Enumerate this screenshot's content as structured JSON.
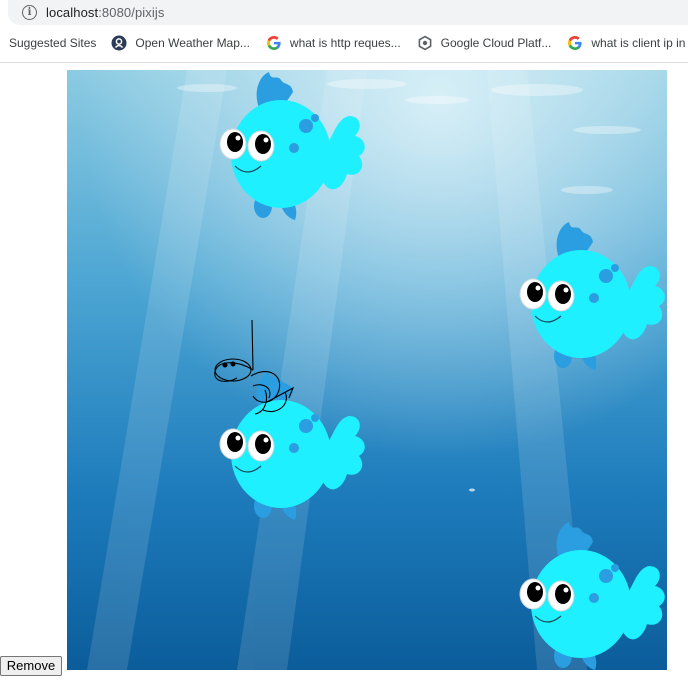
{
  "browser": {
    "url_host": "localhost",
    "url_path": ":8080/pixijs"
  },
  "bookmarks": [
    {
      "label": "Suggested Sites",
      "icon": "none"
    },
    {
      "label": "Open Weather Map...",
      "icon": "openweather-icon"
    },
    {
      "label": "what is http reques...",
      "icon": "google-icon"
    },
    {
      "label": "Google Cloud Platf...",
      "icon": "google-cloud-icon"
    },
    {
      "label": "what is client ip in t",
      "icon": "google-icon"
    }
  ],
  "page": {
    "remove_label": "Remove"
  },
  "colors": {
    "fish_body": "#1ff0ff",
    "fish_fin": "#2a9ee0",
    "water_top": "#7fc3df",
    "water_bottom": "#0b5d9a"
  }
}
